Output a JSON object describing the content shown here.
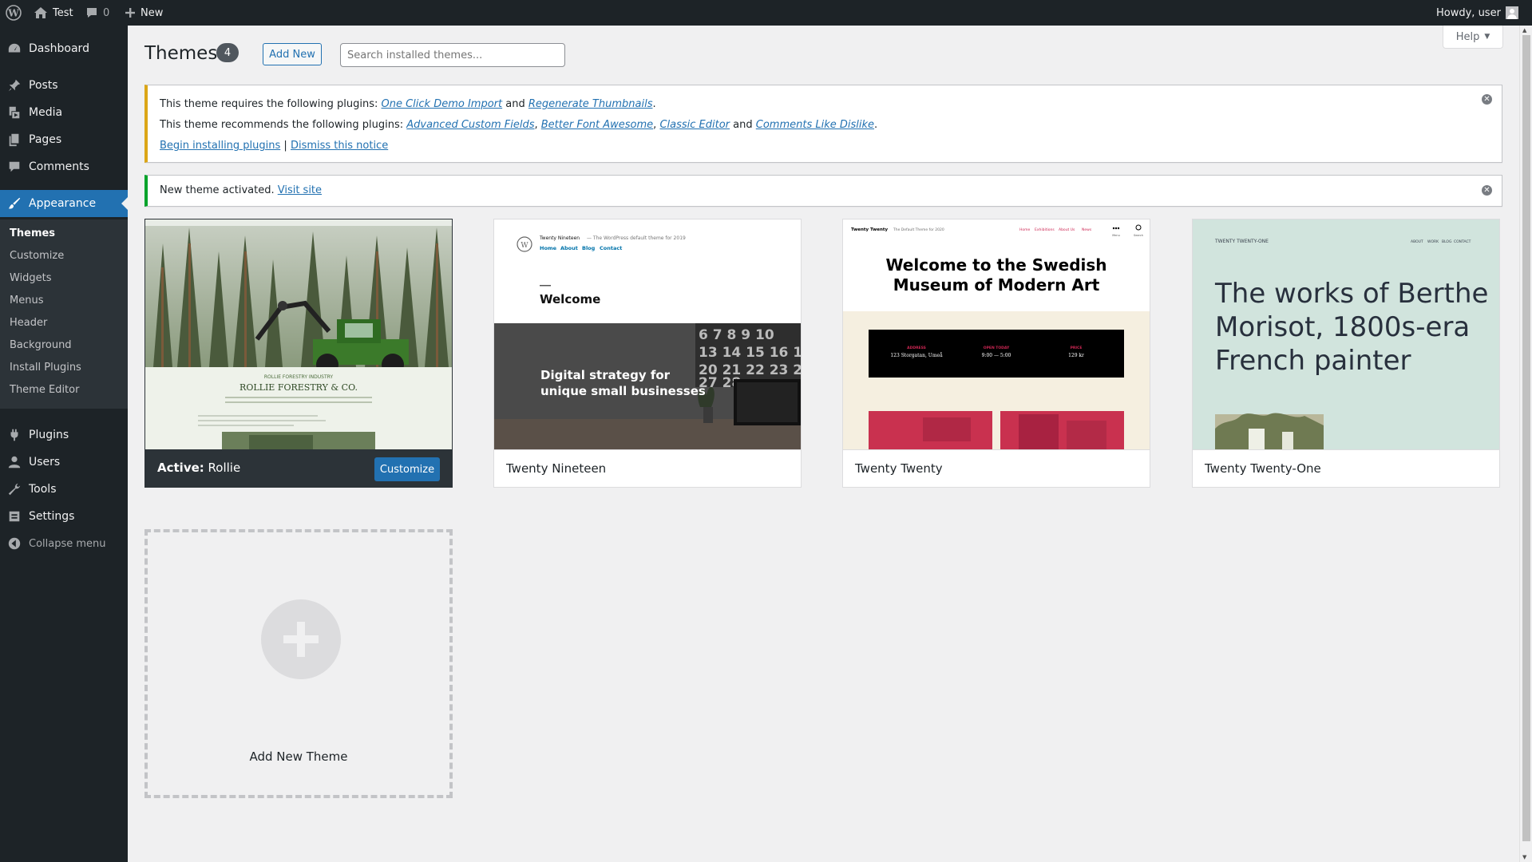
{
  "admin_bar": {
    "site_name": "Test",
    "comment_count": "0",
    "new_label": "New",
    "howdy": "Howdy, user"
  },
  "sidebar": {
    "items": [
      {
        "label": "Dashboard",
        "icon": "dashboard-icon"
      },
      {
        "label": "Posts",
        "icon": "pin-icon"
      },
      {
        "label": "Media",
        "icon": "media-icon"
      },
      {
        "label": "Pages",
        "icon": "pages-icon"
      },
      {
        "label": "Comments",
        "icon": "comment-icon"
      },
      {
        "label": "Appearance",
        "icon": "brush-icon"
      },
      {
        "label": "Plugins",
        "icon": "plug-icon"
      },
      {
        "label": "Users",
        "icon": "user-icon"
      },
      {
        "label": "Tools",
        "icon": "wrench-icon"
      },
      {
        "label": "Settings",
        "icon": "settings-icon"
      },
      {
        "label": "Collapse menu",
        "icon": "collapse-icon"
      }
    ],
    "appearance_submenu": [
      "Themes",
      "Customize",
      "Widgets",
      "Menus",
      "Header",
      "Background",
      "Install Plugins",
      "Theme Editor"
    ]
  },
  "header": {
    "title": "Themes",
    "count": "4",
    "add_new": "Add New",
    "search_placeholder": "Search installed themes...",
    "help": "Help"
  },
  "notices": {
    "plugins": {
      "required_prefix": "This theme requires the following plugins:",
      "required_1": "One Click Demo Import",
      "and_1": "and",
      "required_2": "Regenerate Thumbnails",
      "recommended_prefix": "This theme recommends the following plugins:",
      "recommended_1": "Advanced Custom Fields",
      "recommended_2": "Better Font Awesome",
      "recommended_3": "Classic Editor",
      "and_2": "and",
      "recommended_4": "Comments Like Dislike",
      "begin": "Begin installing plugins",
      "separator": "|",
      "dismiss": "Dismiss this notice"
    },
    "activated": {
      "text": "New theme activated.",
      "link": "Visit site"
    }
  },
  "themes": [
    {
      "active_prefix": "Active:",
      "name": "Rollie",
      "customize": "Customize",
      "shot_text": {
        "industry": "ROLLIE FORESTRY INDUSTRY",
        "company": "ROLLIE FORESTRY & CO."
      }
    },
    {
      "name": "Twenty Nineteen",
      "shot_text": {
        "site": "Twenty Nineteen",
        "tagline": "— The WordPress default theme for 2019",
        "nav": [
          "Home",
          "About",
          "Blog",
          "Contact"
        ],
        "welcome": "Welcome",
        "hero_line1": "Digital strategy for",
        "hero_line2": "unique small businesses"
      }
    },
    {
      "name": "Twenty Twenty",
      "shot_text": {
        "site": "Twenty Twenty",
        "tagline": "The Default Theme for 2020",
        "nav": [
          "Home",
          "Exhibitions",
          "About Us",
          "News"
        ],
        "menu": "Menu",
        "search": "Search",
        "headline_1": "Welcome to the Swedish",
        "headline_2": "Museum of Modern Art",
        "address_label": "ADDRESS",
        "address": "123 Storgatan, Umeå",
        "hours_label": "OPEN TODAY",
        "hours": "9:00 — 5:00",
        "price_label": "PRICE",
        "price": "129 kr"
      }
    },
    {
      "name": "Twenty Twenty-One",
      "shot_text": {
        "site": "TWENTY TWENTY-ONE",
        "nav": [
          "ABOUT",
          "WORK",
          "BLOG",
          "CONTACT"
        ],
        "headline_1": "The works of Berthe",
        "headline_2": "Morisot, 1800s-era",
        "headline_3": "French painter"
      }
    }
  ],
  "add_new_theme": "Add New Theme",
  "colors": {
    "admin_bar": "#1d2327",
    "accent": "#2271b1",
    "warning": "#dba617",
    "success": "#00a32a"
  }
}
